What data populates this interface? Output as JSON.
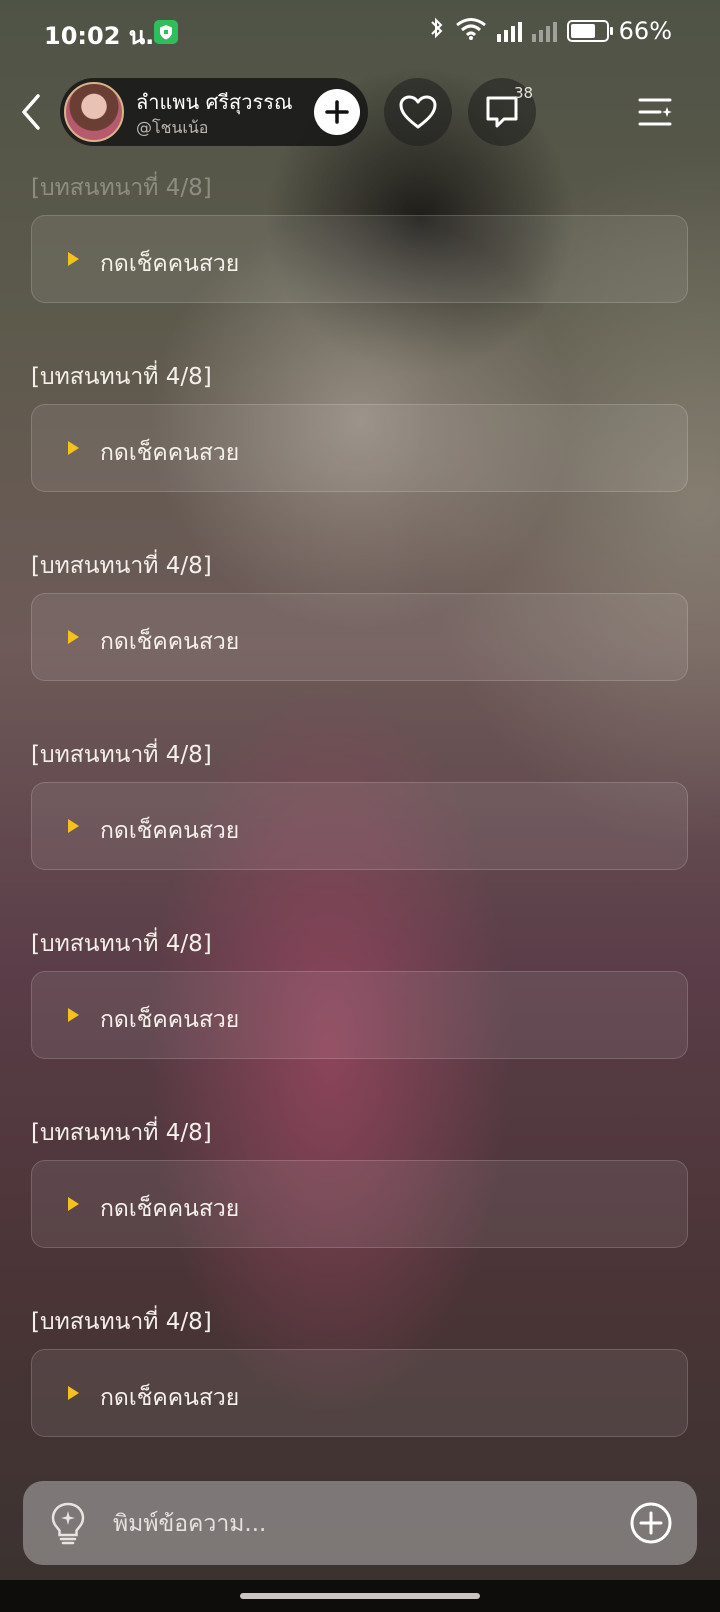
{
  "status_bar": {
    "time": "10:02 น.",
    "battery": "66%"
  },
  "header": {
    "profile_name": "ลำแพน ศรีสุวรรณ",
    "profile_handle": "@โชนเน้อ",
    "comment_count": "38"
  },
  "chat": {
    "items": [
      {
        "label": "[บทสนทนาที่ 4/8]",
        "action": "กดเช็คคนสวย"
      },
      {
        "label": "[บทสนทนาที่ 4/8]",
        "action": "กดเช็คคนสวย"
      },
      {
        "label": "[บทสนทนาที่ 4/8]",
        "action": "กดเช็คคนสวย"
      },
      {
        "label": "[บทสนทนาที่ 4/8]",
        "action": "กดเช็คคนสวย"
      },
      {
        "label": "[บทสนทนาที่ 4/8]",
        "action": "กดเช็คคนสวย"
      },
      {
        "label": "[บทสนทนาที่ 4/8]",
        "action": "กดเช็คคนสวย"
      },
      {
        "label": "[บทสนทนาที่ 4/8]",
        "action": "กดเช็คคนสวย"
      }
    ]
  },
  "input": {
    "placeholder": "พิมพ์ข้อความ..."
  },
  "colors": {
    "accent_play": "#f5c21b",
    "shield_green": "#2fbf5a"
  }
}
